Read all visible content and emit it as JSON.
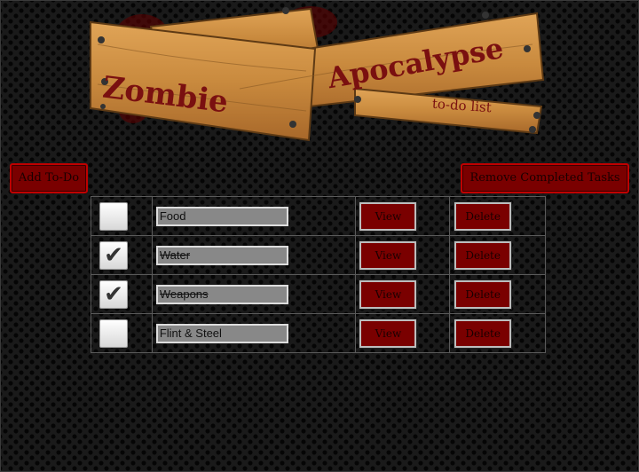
{
  "logo": {
    "word1": "Zombie",
    "word2": "Apocalypse",
    "subtitle": "to-do list"
  },
  "toolbar": {
    "add_label": "Add To-Do",
    "remove_label": "Remove Completed Tasks"
  },
  "todos": [
    {
      "text": "Food",
      "checked": false,
      "view_label": "View",
      "delete_label": "Delete"
    },
    {
      "text": "Water",
      "checked": true,
      "view_label": "View",
      "delete_label": "Delete"
    },
    {
      "text": "Weapons",
      "checked": true,
      "view_label": "View",
      "delete_label": "Delete"
    },
    {
      "text": "Flint & Steel",
      "checked": false,
      "view_label": "View",
      "delete_label": "Delete"
    }
  ],
  "colors": {
    "button_red": "#7a0000",
    "wood": "#c98a3e",
    "blood": "#6a0000"
  }
}
